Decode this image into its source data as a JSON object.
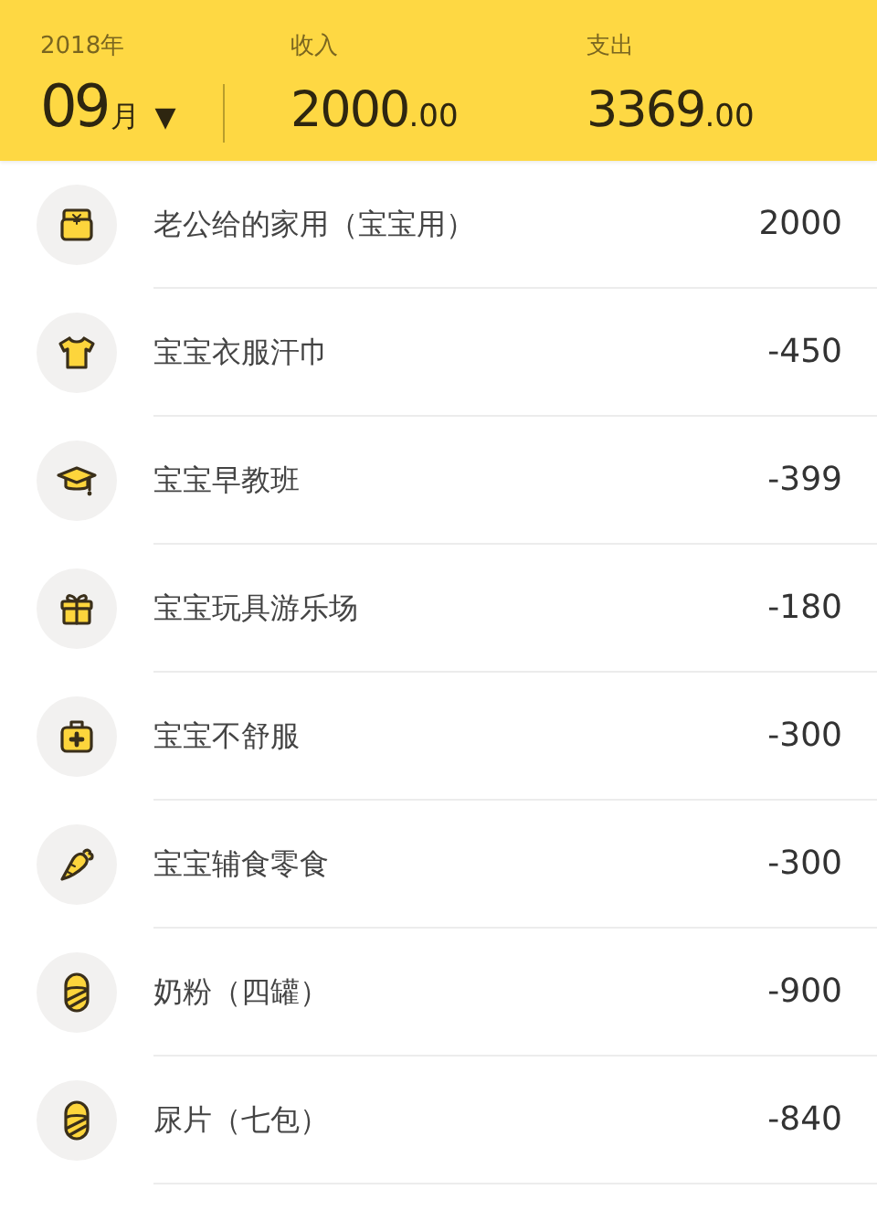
{
  "header": {
    "year": "2018年",
    "month": "09",
    "month_unit": "月",
    "dropdown": "▼",
    "income": {
      "label": "收入",
      "integer": "2000",
      "decimals": ".00"
    },
    "expense": {
      "label": "支出",
      "integer": "3369",
      "decimals": ".00"
    }
  },
  "records": [
    {
      "kind": "wallet",
      "title": "老公给的家用（宝宝用）",
      "amount": "2000"
    },
    {
      "kind": "shirt",
      "title": "宝宝衣服汗巾",
      "amount": "-450"
    },
    {
      "kind": "cap",
      "title": "宝宝早教班",
      "amount": "-399"
    },
    {
      "kind": "gift",
      "title": "宝宝玩具游乐场",
      "amount": "-180"
    },
    {
      "kind": "medkit",
      "title": "宝宝不舒服",
      "amount": "-300"
    },
    {
      "kind": "carrot",
      "title": "宝宝辅食零食",
      "amount": "-300"
    },
    {
      "kind": "baby",
      "title": "奶粉（四罐）",
      "amount": "-900"
    },
    {
      "kind": "baby",
      "title": "尿片（七包）",
      "amount": "-840"
    }
  ]
}
